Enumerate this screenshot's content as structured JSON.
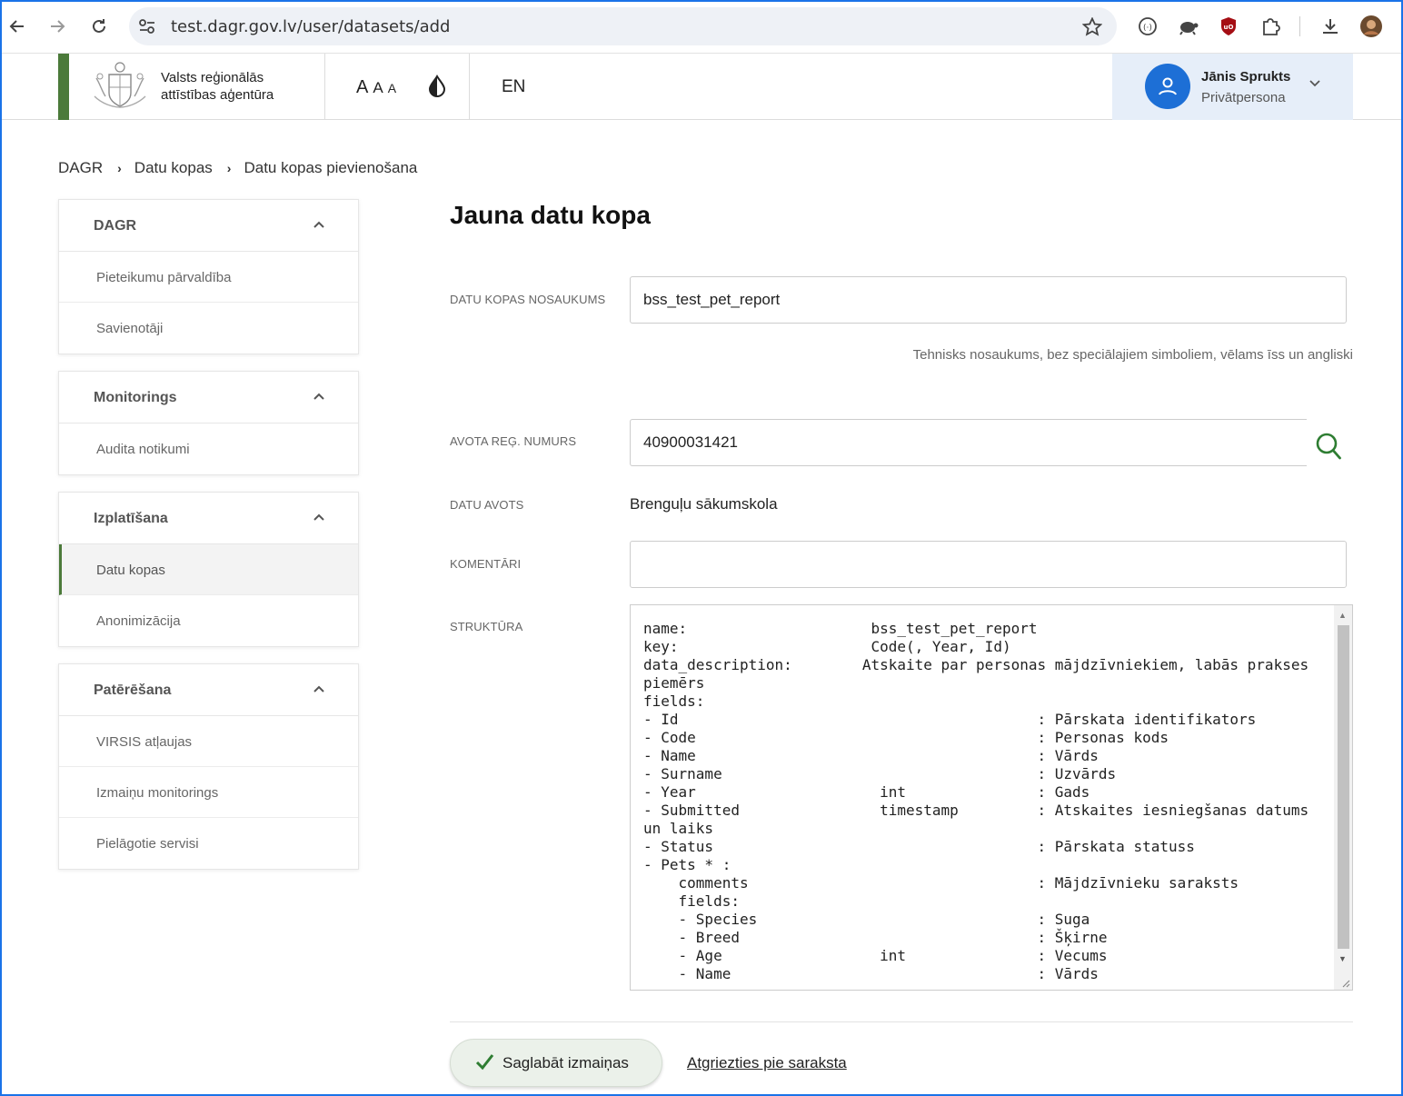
{
  "browser": {
    "url": "test.dagr.gov.lv/user/datasets/add"
  },
  "header": {
    "org_line1": "Valsts reģionālās",
    "org_line2": "attīstības aģentūra",
    "font_a1": "A",
    "font_a2": "A",
    "font_a3": "A",
    "lang": "EN",
    "user_name": "Jānis Sprukts",
    "user_role": "Privātpersona"
  },
  "breadcrumb": [
    "DAGR",
    "Datu kopas",
    "Datu kopas pievienošana"
  ],
  "sidebar": [
    {
      "title": "DAGR",
      "items": [
        "Pieteikumu pārvaldība",
        "Savienotāji"
      ]
    },
    {
      "title": "Monitorings",
      "items": [
        "Audita notikumi"
      ]
    },
    {
      "title": "Izplatīšana",
      "items": [
        "Datu kopas",
        "Anonimizācija"
      ],
      "active_item": "Datu kopas"
    },
    {
      "title": "Patērēšana",
      "items": [
        "VIRSIS atļaujas",
        "Izmaiņu monitorings",
        "Pielāgotie servisi"
      ]
    }
  ],
  "form": {
    "title": "Jauna datu kopa",
    "name_label": "DATU KOPAS NOSAUKUMS",
    "name_value": "bss_test_pet_report",
    "name_hint": "Tehnisks nosaukums, bez speciālajiem simboliem, vēlams īss un angliski",
    "reg_label": "AVOTA REĢ. NUMURS",
    "reg_value": "40900031421",
    "source_label": "DATU AVOTS",
    "source_value": "Brenguļu sākumskola",
    "comments_label": "KOMENTĀRI",
    "comments_value": "",
    "structure_label": "STRUKTŪRA",
    "structure_value": "name:                     bss_test_pet_report\nkey:                      Code(, Year, Id)\ndata_description:        Atskaite par personas mājdzīvniekiem, labās prakses\npiemērs\nfields:\n- Id                                         : Pārskata identifikators\n- Code                                       : Personas kods\n- Name                                       : Vārds\n- Surname                                    : Uzvārds\n- Year                     int               : Gads\n- Submitted                timestamp         : Atskaites iesniegšanas datums\nun laiks\n- Status                                     : Pārskata statuss\n- Pets * :\n    comments                                 : Mājdzīvnieku saraksts\n    fields:\n    - Species                                : Suga\n    - Breed                                  : Šķirne\n    - Age                  int               : Vecums\n    - Name                                   : Vārds",
    "save_label": "Saglabāt izmaiņas",
    "back_label": "Atgriezties pie saraksta"
  },
  "colors": {
    "accent_green": "#4b7a3a",
    "user_blue": "#1d6fd6",
    "search_green": "#2e7d32"
  }
}
